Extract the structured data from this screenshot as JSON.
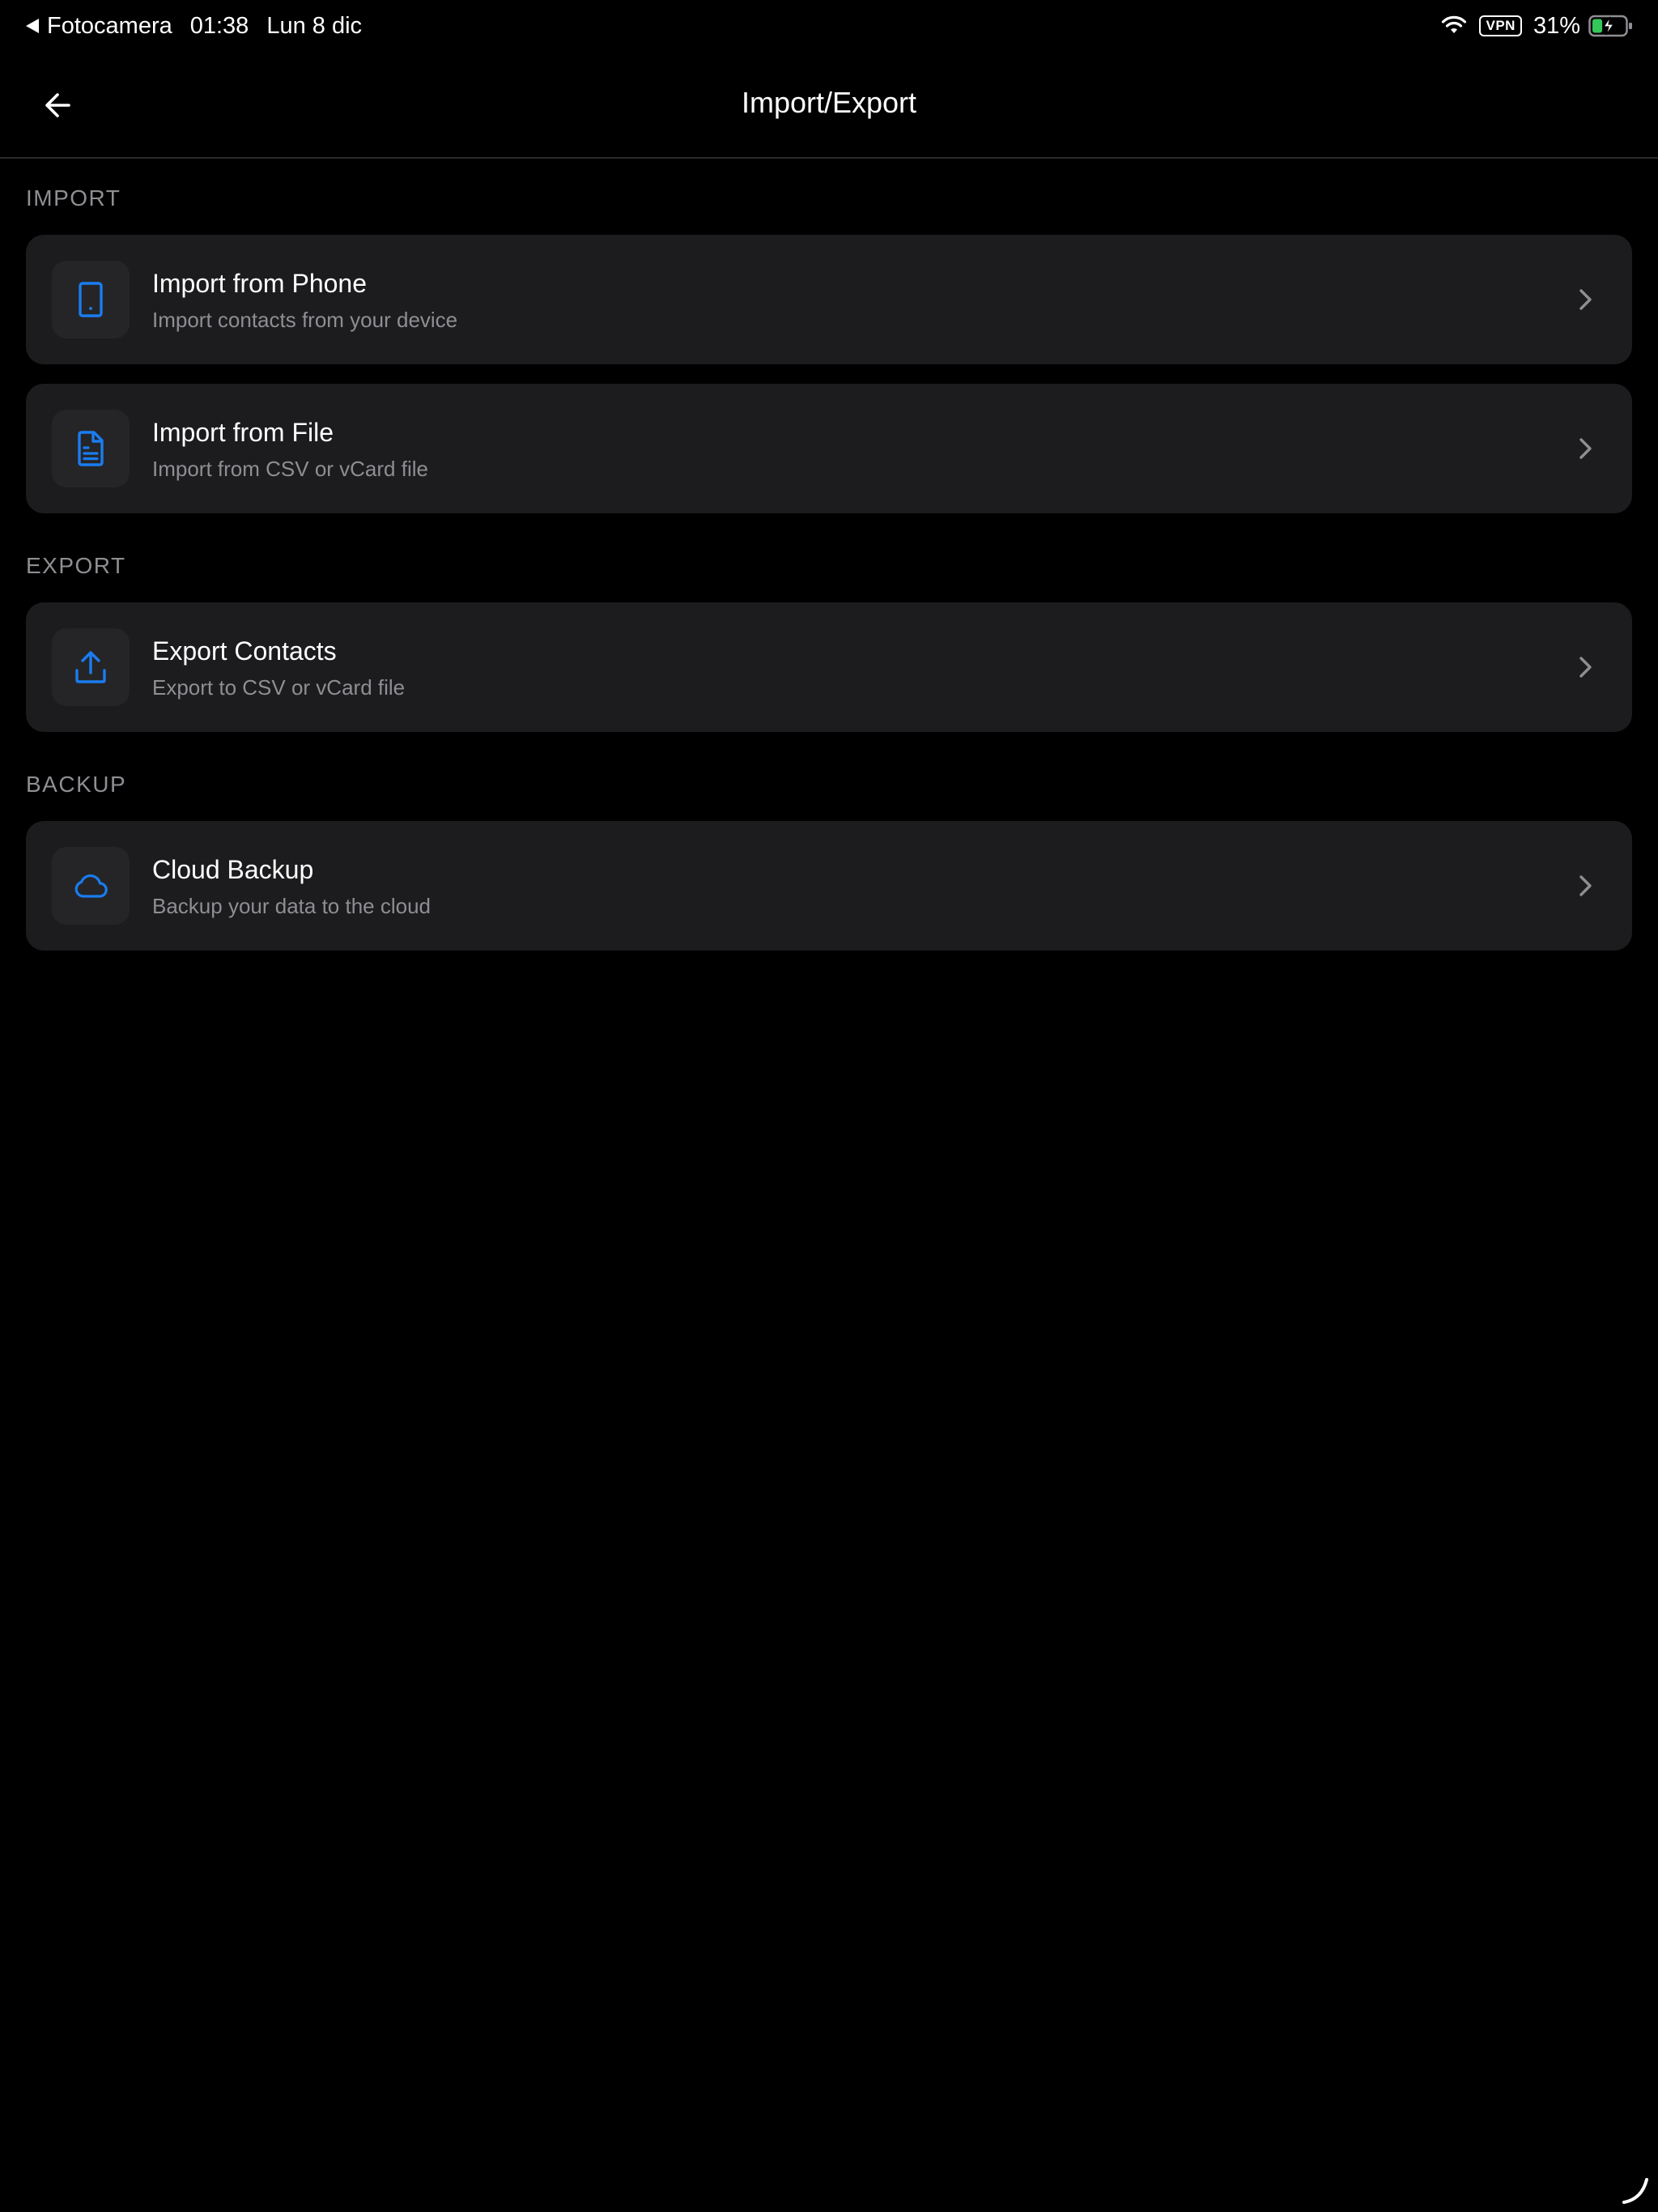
{
  "status_bar": {
    "back_app": "Fotocamera",
    "time": "01:38",
    "date": "Lun 8 dic",
    "vpn": "VPN",
    "battery_percent": "31%",
    "battery_level": 0.31,
    "battery_charging": true
  },
  "header": {
    "title": "Import/Export",
    "back_icon": "arrow-left-icon"
  },
  "colors": {
    "background": "#000000",
    "card": "#1c1c1e",
    "icon_box": "#252527",
    "accent": "#1a7cf0",
    "secondary_text": "#8e8e93",
    "battery_green": "#34c759"
  },
  "sections": {
    "import": {
      "header": "IMPORT",
      "items": [
        {
          "title": "Import from Phone",
          "subtitle": "Import contacts from your device",
          "icon": "phone-icon"
        },
        {
          "title": "Import from File",
          "subtitle": "Import from CSV or vCard file",
          "icon": "file-icon"
        }
      ]
    },
    "export": {
      "header": "EXPORT",
      "items": [
        {
          "title": "Export Contacts",
          "subtitle": "Export to CSV or vCard file",
          "icon": "upload-icon"
        }
      ]
    },
    "backup": {
      "header": "BACKUP",
      "items": [
        {
          "title": "Cloud Backup",
          "subtitle": "Backup your data to the cloud",
          "icon": "cloud-icon"
        }
      ]
    }
  }
}
